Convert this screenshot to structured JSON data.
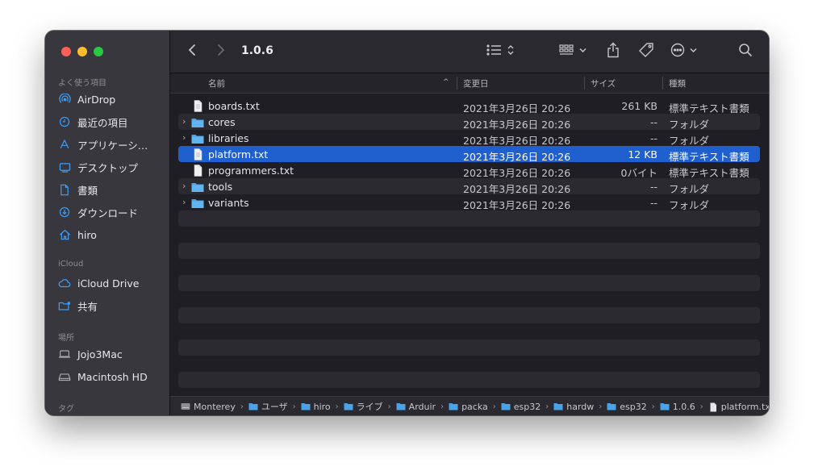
{
  "window": {
    "title": "1.0.6"
  },
  "sidebar": {
    "favorites_heading": "よく使う項目",
    "favorites": [
      {
        "label": "AirDrop",
        "icon": "airdrop-icon"
      },
      {
        "label": "最近の項目",
        "icon": "clock-icon"
      },
      {
        "label": "アプリケーシ…",
        "icon": "applications-icon"
      },
      {
        "label": "デスクトップ",
        "icon": "desktop-icon"
      },
      {
        "label": "書類",
        "icon": "document-icon"
      },
      {
        "label": "ダウンロード",
        "icon": "download-icon"
      },
      {
        "label": "hiro",
        "icon": "home-icon"
      }
    ],
    "icloud_heading": "iCloud",
    "icloud": [
      {
        "label": "iCloud Drive",
        "icon": "cloud-icon"
      },
      {
        "label": "共有",
        "icon": "shared-folder-icon"
      }
    ],
    "locations_heading": "場所",
    "locations": [
      {
        "label": "Jojo3Mac",
        "icon": "laptop-icon"
      },
      {
        "label": "Macintosh HD",
        "icon": "disk-icon"
      }
    ],
    "tags_heading": "タグ"
  },
  "columns": {
    "name": "名前",
    "date": "変更日",
    "size": "サイズ",
    "kind": "種類"
  },
  "files": [
    {
      "name": "boards.txt",
      "date": "2021年3月26日 20:26",
      "size": "261 KB",
      "kind": "標準テキスト書類",
      "type": "file"
    },
    {
      "name": "cores",
      "date": "2021年3月26日 20:26",
      "size": "--",
      "kind": "フォルダ",
      "type": "folder"
    },
    {
      "name": "libraries",
      "date": "2021年3月26日 20:26",
      "size": "--",
      "kind": "フォルダ",
      "type": "folder"
    },
    {
      "name": "platform.txt",
      "date": "2021年3月26日 20:26",
      "size": "12 KB",
      "kind": "標準テキスト書類",
      "type": "file",
      "selected": true
    },
    {
      "name": "programmers.txt",
      "date": "2021年3月26日 20:26",
      "size": "0バイト",
      "kind": "標準テキスト書類",
      "type": "file"
    },
    {
      "name": "tools",
      "date": "2021年3月26日 20:26",
      "size": "--",
      "kind": "フォルダ",
      "type": "folder"
    },
    {
      "name": "variants",
      "date": "2021年3月26日 20:26",
      "size": "--",
      "kind": "フォルダ",
      "type": "folder"
    }
  ],
  "path": [
    {
      "label": "Monterey",
      "icon": "disk-icon"
    },
    {
      "label": "ユーザ",
      "icon": "folder-icon"
    },
    {
      "label": "hiro",
      "icon": "folder-icon"
    },
    {
      "label": "ライブ",
      "icon": "folder-icon"
    },
    {
      "label": "Arduir",
      "icon": "folder-icon"
    },
    {
      "label": "packa",
      "icon": "folder-icon"
    },
    {
      "label": "esp32",
      "icon": "folder-icon"
    },
    {
      "label": "hardw",
      "icon": "folder-icon"
    },
    {
      "label": "esp32",
      "icon": "folder-icon"
    },
    {
      "label": "1.0.6",
      "icon": "folder-icon"
    },
    {
      "label": "platform.txt",
      "icon": "file-icon"
    }
  ],
  "colors": {
    "accent": "#3c9cf6",
    "selection": "#1f5fce",
    "folder": "#4aa3e8"
  }
}
